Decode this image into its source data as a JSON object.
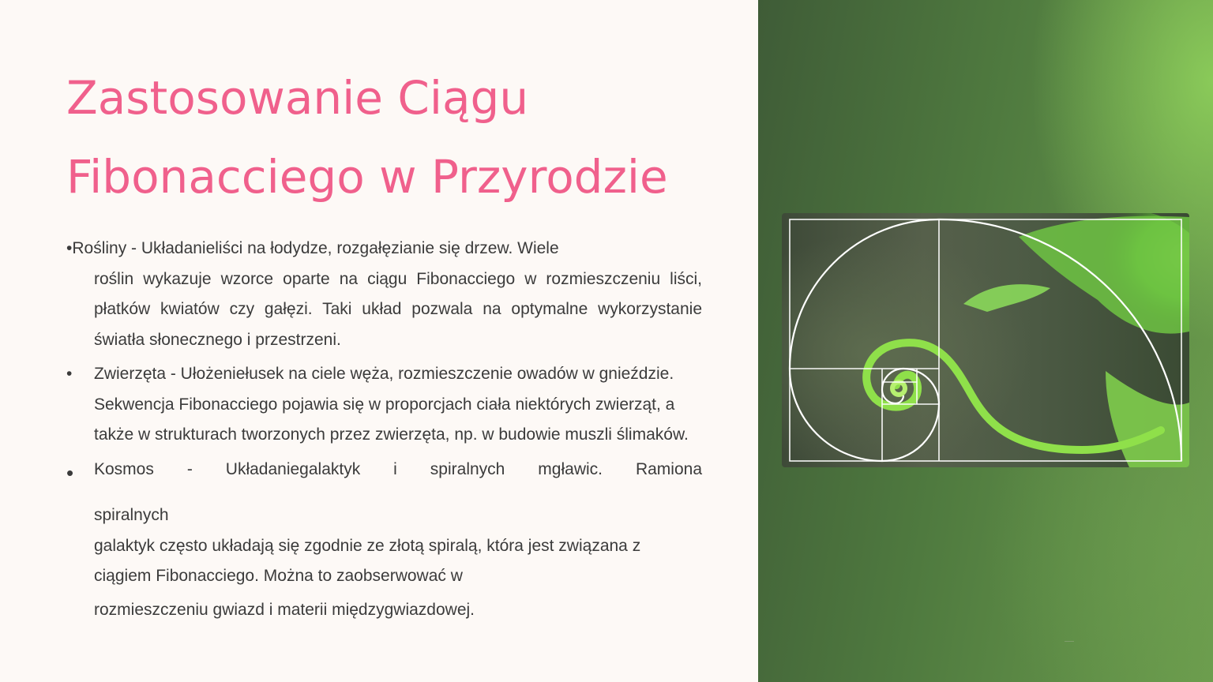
{
  "slide": {
    "title_line1": "Zastosowanie Ciągu",
    "title_line2": "Fibonacciego w Przyrodzie",
    "items": [
      {
        "bullet": "•",
        "first_line": "Rośliny - Układanieliści na łodydze, rozgałęzianie się drzew. Wiele",
        "rest": "roślin wykazuje wzorce oparte na ciągu Fibonacciego w rozmieszczeniu liści, płatków kwiatów czy gałęzi. Taki układ pozwala na optymalne wykorzystanie światła słonecznego i przestrzeni."
      },
      {
        "bullet": "•",
        "text": "Zwierzęta - Ułożeniełusek na ciele węża, rozmieszczenie owadów w gnieździe. Sekwencja Fibonacciego pojawia się w proporcjach ciała niektórych zwierząt, a także w strukturach tworzonych przez zwierzęta, np. w budowie muszli ślimaków."
      },
      {
        "bullet": "•",
        "line1": "Kosmos - Układaniegalaktyk i spiralnych mgławic. Ramiona",
        "line2": "spiralnych",
        "line3": "galaktyk często układają się zgodnie ze złotą spiralą, która jest związana z ciągiem Fibonacciego. Można to zaobserwować w",
        "line4": "rozmieszczeniu gwiazd i materii międzygwiazdowej."
      }
    ]
  },
  "colors": {
    "title": "#f0608c",
    "text": "#3b3b3b",
    "background": "#fdf9f6",
    "panel_green": "#4f7a3f"
  }
}
